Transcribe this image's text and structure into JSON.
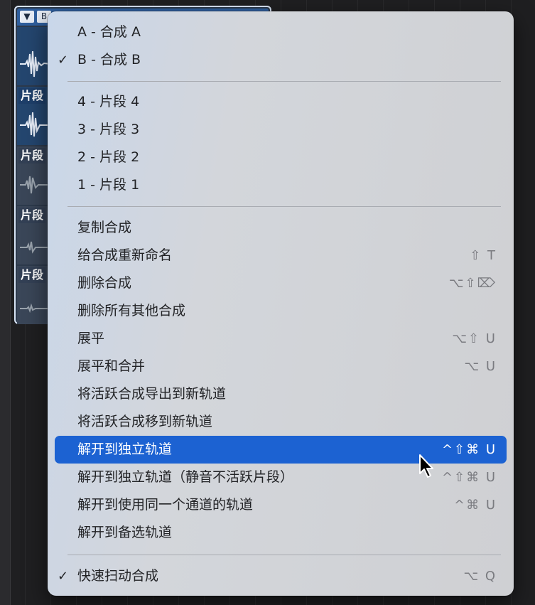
{
  "take_folder": {
    "header_collapse_glyph": "▼",
    "header_take_letter": "B",
    "lanes": [
      {
        "label": "片段"
      },
      {
        "label": "片段"
      },
      {
        "label": "片段"
      },
      {
        "label": "片段"
      }
    ]
  },
  "menu": {
    "comp_items": [
      {
        "label": "A - 合成 A",
        "checked": false
      },
      {
        "label": "B - 合成 B",
        "checked": true,
        "check_glyph": "✓"
      }
    ],
    "take_items": [
      {
        "label": "4 - 片段 4"
      },
      {
        "label": "3 - 片段 3"
      },
      {
        "label": "2 - 片段 2"
      },
      {
        "label": "1 - 片段 1"
      }
    ],
    "action_items": [
      {
        "label": "复制合成",
        "shortcut": ""
      },
      {
        "label": "给合成重新命名",
        "shortcut": "⇧ T"
      },
      {
        "label": "删除合成",
        "shortcut": "⌥⇧⌦"
      },
      {
        "label": "删除所有其他合成",
        "shortcut": ""
      },
      {
        "label": "展平",
        "shortcut": "⌥⇧ U"
      },
      {
        "label": "展平和合并",
        "shortcut": "⌥ U"
      },
      {
        "label": "将活跃合成导出到新轨道",
        "shortcut": ""
      },
      {
        "label": "将活跃合成移到新轨道",
        "shortcut": ""
      },
      {
        "label": "解开到独立轨道",
        "shortcut": "^⇧⌘ U",
        "highlighted": true
      },
      {
        "label": "解开到独立轨道（静音不活跃片段）",
        "shortcut": "^⇧⌘ U"
      },
      {
        "label": "解开到使用同一个通道的轨道",
        "shortcut": "^⌘ U"
      },
      {
        "label": "解开到备选轨道",
        "shortcut": ""
      }
    ],
    "quick_swipe": {
      "label": "快速扫动合成",
      "checked": true,
      "check_glyph": "✓",
      "shortcut": "⌥ Q"
    }
  },
  "colors": {
    "highlight": "#1c62d2",
    "menu_bg": "#d0d2d6",
    "take_folder_header": "#2f5f9e"
  }
}
